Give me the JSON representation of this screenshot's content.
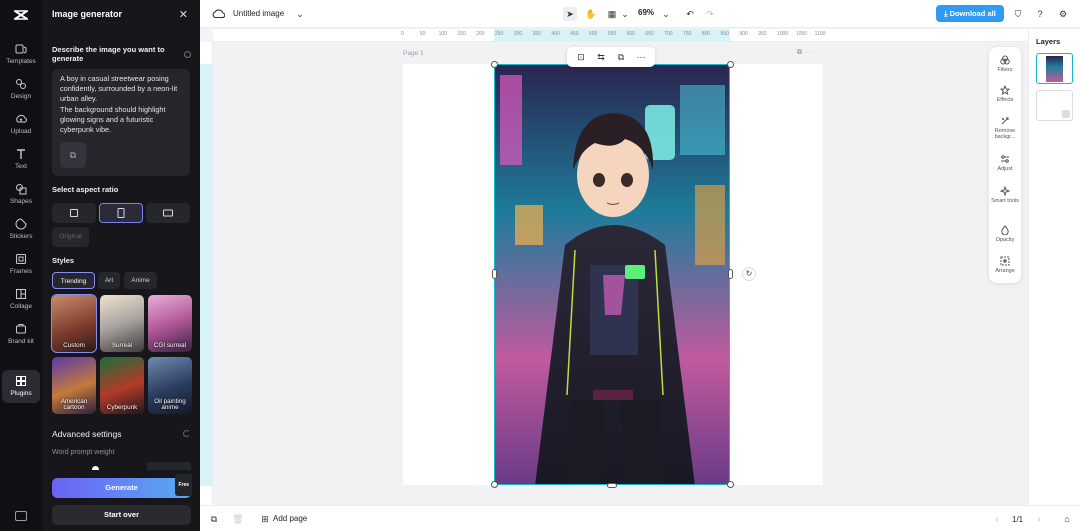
{
  "rail": {
    "items": [
      {
        "label": "Templates",
        "icon": "templates-icon"
      },
      {
        "label": "Design",
        "icon": "design-icon"
      },
      {
        "label": "Upload",
        "icon": "upload-icon"
      },
      {
        "label": "Text",
        "icon": "text-icon"
      },
      {
        "label": "Shapes",
        "icon": "shapes-icon"
      },
      {
        "label": "Stickers",
        "icon": "stickers-icon"
      },
      {
        "label": "Frames",
        "icon": "frames-icon"
      },
      {
        "label": "Collage",
        "icon": "collage-icon"
      },
      {
        "label": "Brand kit",
        "icon": "brand-kit-icon"
      },
      {
        "label": "Plugins",
        "icon": "plugins-icon"
      }
    ],
    "active": "Plugins"
  },
  "panel": {
    "title": "Image generator",
    "describe_label": "Describe the image you want to generate",
    "prompt": "A boy in casual streetwear posing confidently, surrounded by a neon-lit urban alley.\nThe background should highlight glowing signs and a futuristic cyberpunk vibe.",
    "aspect_label": "Select aspect ratio",
    "original_label": "Original",
    "styles_label": "Styles",
    "style_tabs": [
      "Trending",
      "Art",
      "Anime"
    ],
    "style_cards": [
      "Custom",
      "Surreal",
      "CGI surreal",
      "American cartoon",
      "Cyberpunk",
      "Oil painting anime"
    ],
    "advanced_label": "Advanced settings",
    "word_weight_label": "Word prompt weight",
    "generate_label": "Generate",
    "free_badge": "Free",
    "start_over_label": "Start over"
  },
  "topbar": {
    "doc_title": "Untitled image",
    "zoom": "69%",
    "download_label": "Download all"
  },
  "ruler": {
    "h_ticks": [
      "0",
      "50",
      "100",
      "150",
      "200",
      "250",
      "300",
      "350",
      "400",
      "450",
      "500",
      "550",
      "600",
      "650",
      "700",
      "750",
      "800",
      "850",
      "900",
      "950",
      "1000",
      "1050",
      "1100"
    ]
  },
  "canvas": {
    "page_label": "Page 1"
  },
  "right_tools": [
    "Filters",
    "Effects",
    "Remove backgr...",
    "Adjust",
    "Smart tools",
    "Opacity",
    "Arrange"
  ],
  "layers": {
    "title": "Layers"
  },
  "bottom": {
    "add_page_label": "Add page",
    "page_counter": "1/1"
  },
  "colors": {
    "accent": "#19b7c9",
    "primary_button": "#2f9bf2",
    "generate_gradient_start": "#6a63f3",
    "generate_gradient_end": "#5aa9f4"
  }
}
